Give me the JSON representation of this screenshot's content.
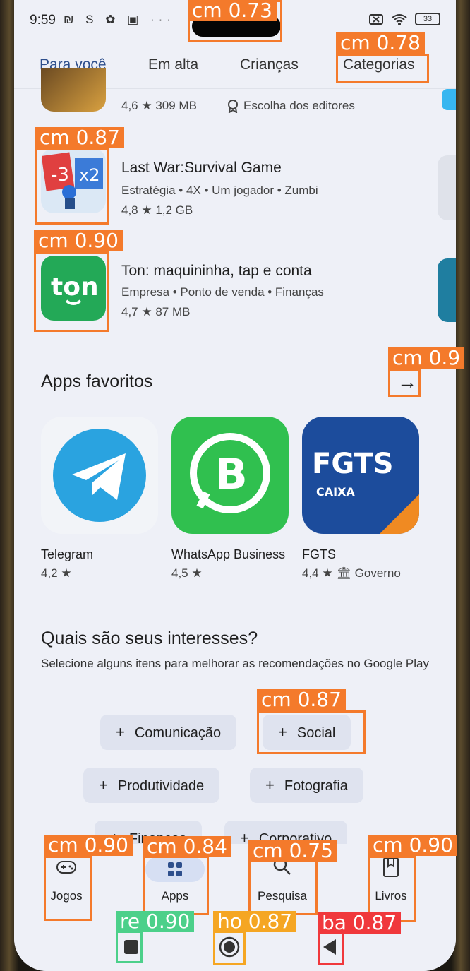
{
  "status_bar": {
    "time": "9:59",
    "left_icons": "₪ S ✿ ▣ ···",
    "battery": "33"
  },
  "tabs": [
    "Para você",
    "Em alta",
    "Crianças",
    "Categorias"
  ],
  "top_partial_row": {
    "stats": "4,6 ★   309 MB",
    "badge": "Escolha dos editores"
  },
  "apps": [
    {
      "name": "Last War:Survival Game",
      "meta": "Estratégia • 4X • Um jogador • Zumbi",
      "stats": "4,8 ★   1,2 GB"
    },
    {
      "name": "Ton: maquininha, tap e conta",
      "meta": "Empresa • Ponto de venda • Finanças",
      "stats": "4,7 ★   87 MB"
    }
  ],
  "favorites": {
    "title": "Apps favoritos",
    "items": [
      {
        "name": "Telegram",
        "rating": "4,2 ★",
        "icon": "telegram-icon"
      },
      {
        "name": "WhatsApp Business",
        "rating": "4,5 ★",
        "icon": "whatsapp-business-icon"
      },
      {
        "name": "FGTS",
        "rating": "4,4 ★",
        "extra": "Governo",
        "icon": "fgts-icon"
      }
    ]
  },
  "interests": {
    "title": "Quais são seus interesses?",
    "subtitle": "Selecione alguns itens para melhorar as recomendações no Google Play",
    "chips": [
      "Comunicação",
      "Social",
      "Produtividade",
      "Fotografia",
      "Finanças",
      "Corporativo"
    ]
  },
  "bottom_nav": [
    {
      "label": "Jogos",
      "icon": "gamepad-icon"
    },
    {
      "label": "Apps",
      "icon": "apps-grid-icon"
    },
    {
      "label": "Pesquisa",
      "icon": "search-icon"
    },
    {
      "label": "Livros",
      "icon": "book-icon"
    }
  ],
  "detections": [
    {
      "label": "cm  0.73"
    },
    {
      "label": "cm  0.78"
    },
    {
      "label": "cm  0.87"
    },
    {
      "label": "cm  0.90"
    },
    {
      "label": "cm  0.9"
    },
    {
      "label": "cm  0.87"
    },
    {
      "label": "cm  0.90"
    },
    {
      "label": "cm  0.84"
    },
    {
      "label": "cm  0.75"
    },
    {
      "label": "cm  0.90"
    },
    {
      "label": "re  0.90"
    },
    {
      "label": "ho  0.87"
    },
    {
      "label": "ba  0.87"
    }
  ],
  "colors": {
    "accent": "#2e4f8c",
    "detection_orange": "#f47a2b",
    "detection_green": "#4cd08a",
    "detection_gold": "#f5a623",
    "detection_red": "#f0383c"
  }
}
